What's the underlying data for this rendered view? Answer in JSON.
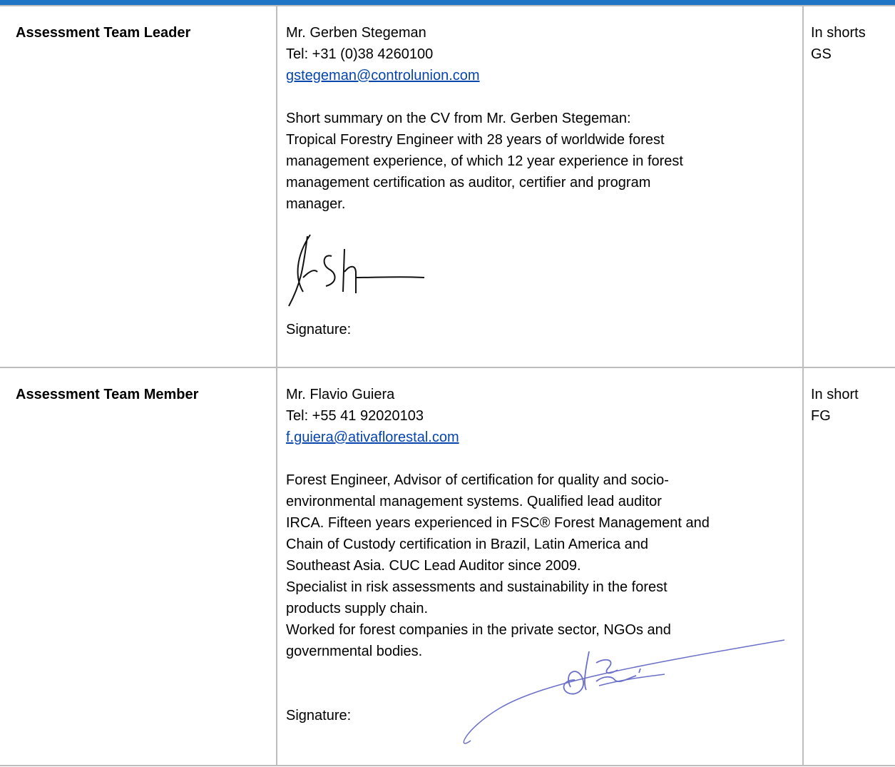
{
  "colors": {
    "header_bar": "#1f74c4",
    "table_border": "#bdbdbd",
    "link": "#0645ad",
    "signature_ink_1": "#111111",
    "signature_ink_2": "#6a6fc9"
  },
  "rows": [
    {
      "role": "Assessment Team Leader",
      "name": "Mr. Gerben Stegeman",
      "tel": "Tel: +31 (0)38 4260100",
      "email": "gstegeman@controlunion.com",
      "summary_intro": "Short summary on the CV from Mr. Gerben Stegeman:",
      "summary_lines": [
        "Tropical Forestry Engineer with 28 years of worldwide forest",
        "management experience, of which 12 year experience in  forest",
        "management certification as auditor, certifier and program",
        "manager."
      ],
      "signature_label": "Signature:",
      "short_label": "In shorts",
      "short_code": "GS"
    },
    {
      "role": "Assessment Team Member",
      "name": "Mr. Flavio Guiera",
      "tel": "Tel: +55 41 92020103",
      "email": "f.guiera@ativaflorestal.com",
      "summary_lines": [
        "Forest Engineer, Advisor of certification for quality and socio-",
        "environmental management systems. Qualified lead auditor",
        "IRCA. Fifteen years experienced in FSC® Forest Management and",
        "Chain of Custody certification in Brazil, Latin America and",
        "Southeast Asia. CUC Lead Auditor since 2009.",
        "Specialist in risk assessments and sustainability in the forest",
        "products supply chain.",
        "Worked for forest companies in the private sector, NGOs and",
        "governmental bodies."
      ],
      "signature_label": "Signature:",
      "short_label": "In short",
      "short_code": "FG"
    }
  ]
}
